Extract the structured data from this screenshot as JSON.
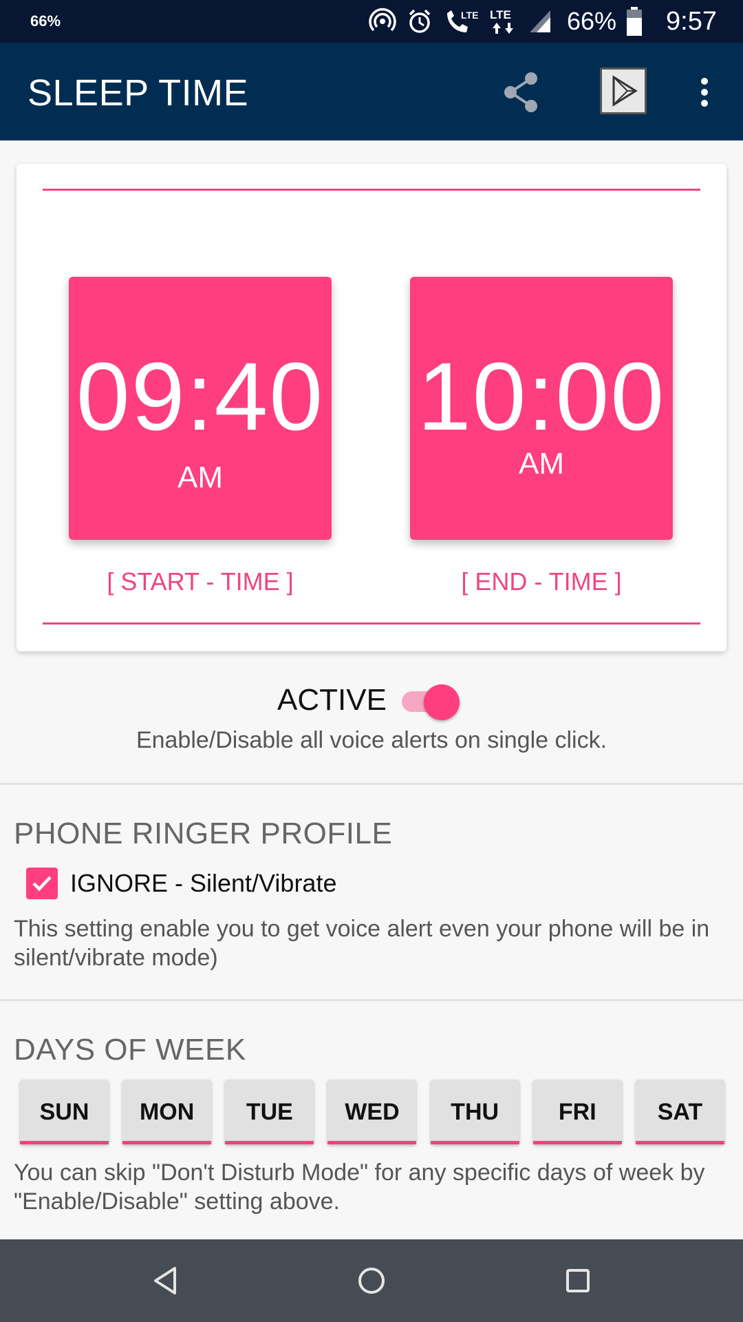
{
  "status_bar": {
    "left_text": "66%",
    "battery_percent": "66%",
    "time": "9:57",
    "icons": [
      "hotspot-icon",
      "alarm-icon",
      "lte-call-icon",
      "lte-data-icon",
      "signal-icon",
      "battery-icon"
    ]
  },
  "app_bar": {
    "title": "SLEEP TIME",
    "icons": [
      "share-icon",
      "play-store-icon",
      "more-vert-icon"
    ]
  },
  "time_card": {
    "start": {
      "time": "09:40",
      "ampm": "AM",
      "caption": "[ START - TIME ]"
    },
    "end": {
      "time": "10:00",
      "ampm": "AM",
      "caption": "[ END - TIME ]"
    }
  },
  "active": {
    "label": "ACTIVE",
    "enabled": true,
    "description": "Enable/Disable all voice alerts on single click."
  },
  "ringer": {
    "title": "PHONE RINGER PROFILE",
    "checkbox_label": "IGNORE - Silent/Vibrate",
    "checked": true,
    "description": "This setting enable you to get voice alert even your phone will be in silent/vibrate mode)"
  },
  "days": {
    "title": "DAYS OF WEEK",
    "items": [
      "SUN",
      "MON",
      "TUE",
      "WED",
      "THU",
      "FRI",
      "SAT"
    ],
    "description": "You can skip \"Don't Disturb Mode\" for any specific days of week by \"Enable/Disable\" setting above."
  },
  "nav_bar": {
    "icons": [
      "back-icon",
      "home-icon",
      "recents-icon"
    ]
  },
  "colors": {
    "accent": "#fe3e7e",
    "app_bar": "#022d53",
    "status_bar": "#081634",
    "nav_bar": "#464c53"
  }
}
